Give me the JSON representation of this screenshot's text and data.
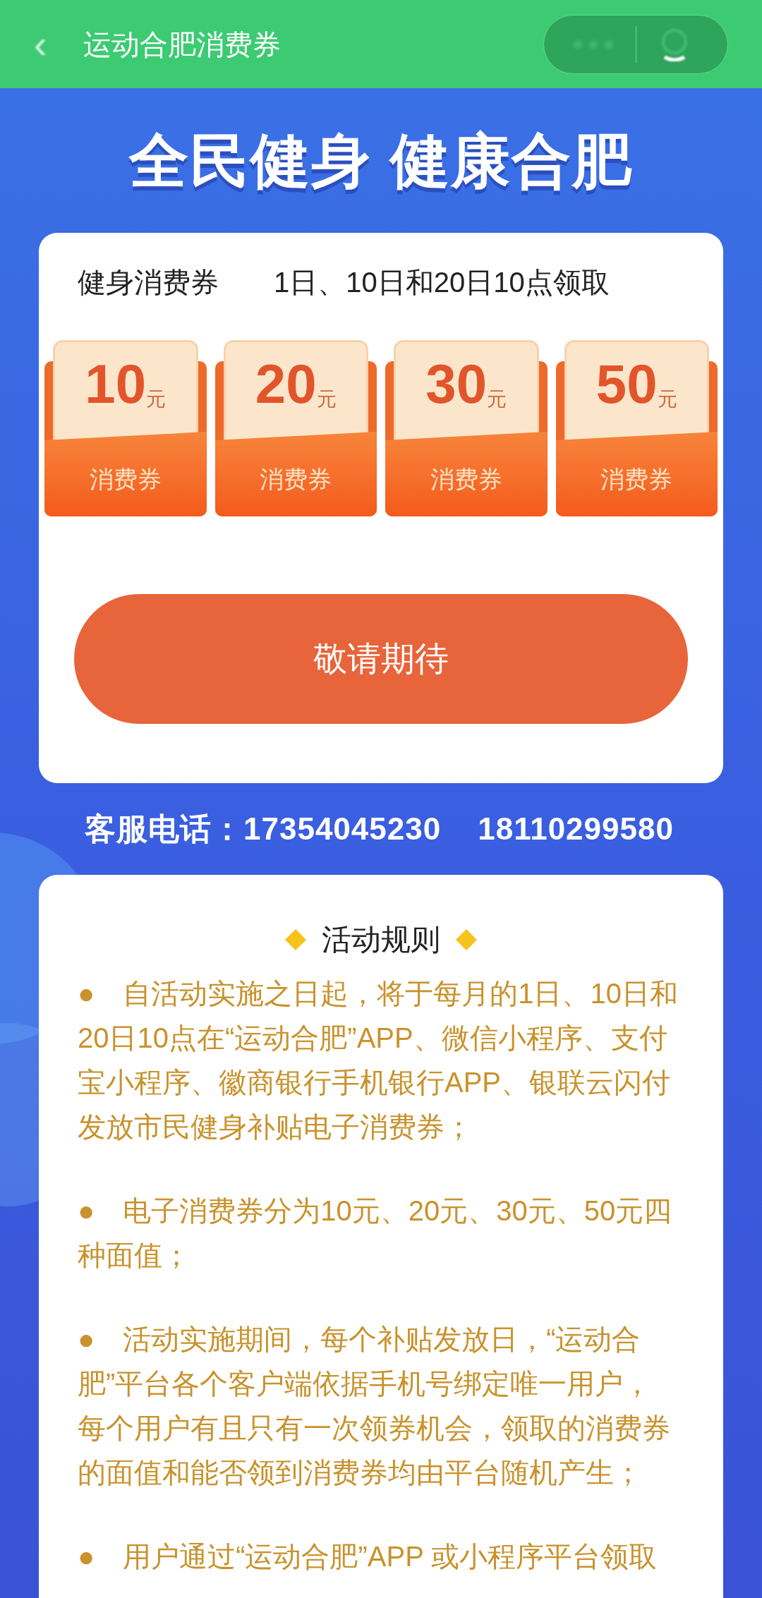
{
  "header": {
    "back": "‹",
    "title": "运动合肥消费券"
  },
  "banner": {
    "title": "全民健身 健康合肥"
  },
  "voucher_card": {
    "title": "健身消费券",
    "schedule": "1日、10日和20日10点领取",
    "coupons": [
      {
        "amount": "10",
        "unit": "元",
        "label": "消费券"
      },
      {
        "amount": "20",
        "unit": "元",
        "label": "消费券"
      },
      {
        "amount": "30",
        "unit": "元",
        "label": "消费券"
      },
      {
        "amount": "50",
        "unit": "元",
        "label": "消费券"
      }
    ],
    "button": {
      "label": "敬请期待",
      "disabled": true
    }
  },
  "hotline": {
    "label": "客服电话：",
    "numbers": [
      "17354045230",
      "18110299580"
    ]
  },
  "rules": {
    "title": "活动规则",
    "items": [
      "●　自活动实施之日起，将于每月的1日、10日和20日10点在“运动合肥”APP、微信小程序、支付宝小程序、徽商银行手机银行APP、银联云闪付发放市民健身补贴电子消费券；",
      "●　电子消费券分为10元、20元、30元、50元四种面值；",
      "●　活动实施期间，每个补贴发放日，“运动合肥”平台各个客户端依据手机号绑定唯一用户，每个用户有且只有一次领券机会，领取的消费券的面值和能否领到消费券均由平台随机产生；",
      "●　用户通过“运动合肥”APP 或小程序平台领取"
    ]
  }
}
